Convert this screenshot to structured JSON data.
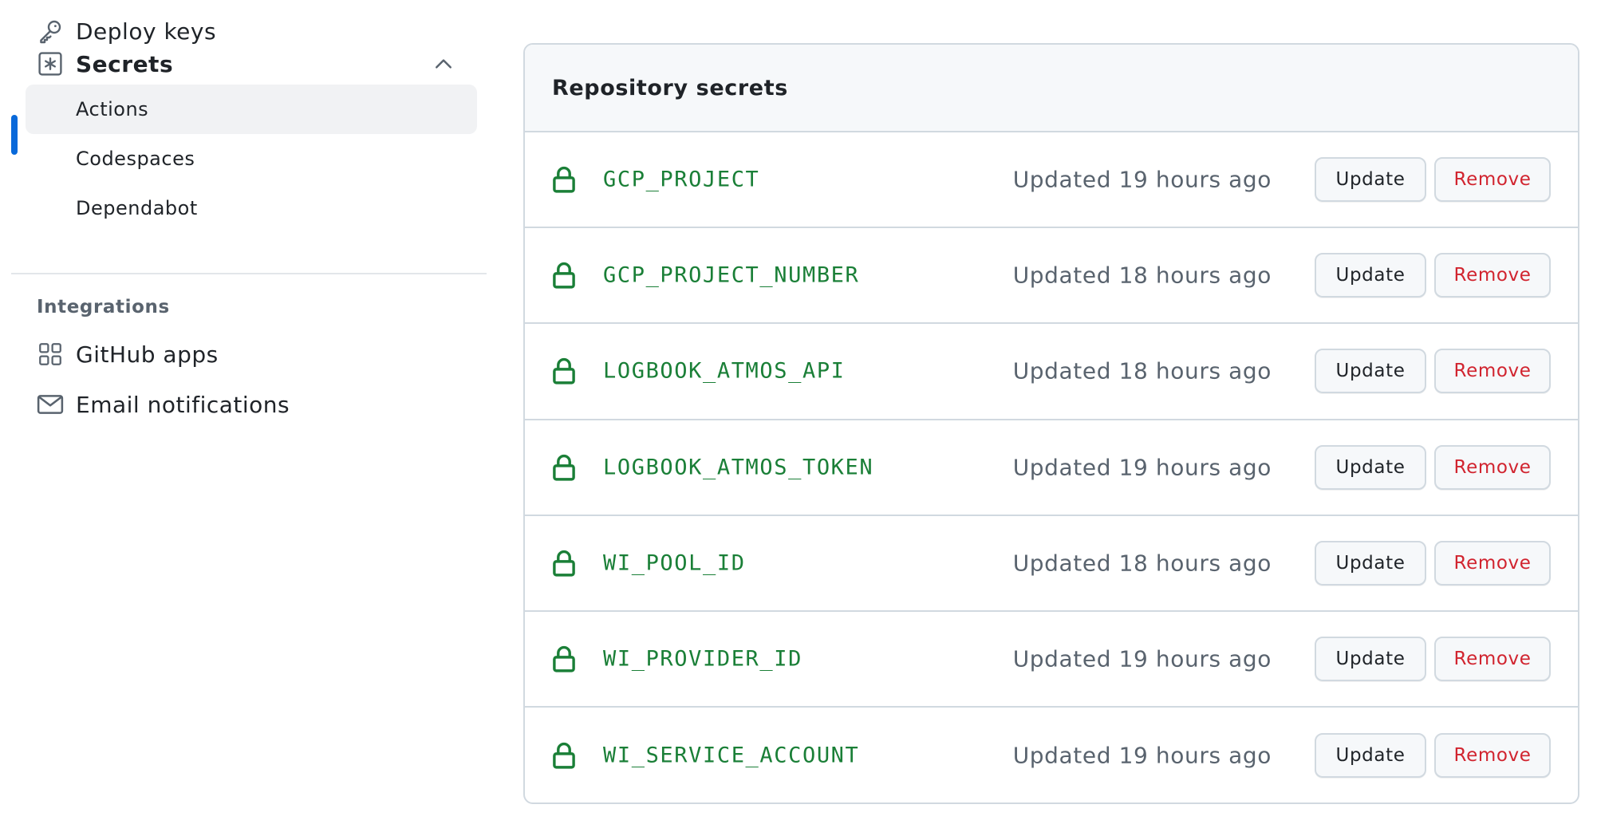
{
  "colors": {
    "accent": "#0969da",
    "secret_name": "#1a7f37",
    "danger": "#d1242f",
    "muted": "#59636e",
    "border": "#d1d9e0"
  },
  "sidebar": {
    "deploy_keys": {
      "label": "Deploy keys",
      "icon": "key-icon"
    },
    "secrets": {
      "label": "Secrets",
      "icon": "asterisk-box-icon",
      "expanded": true,
      "items": [
        {
          "label": "Actions",
          "active": true
        },
        {
          "label": "Codespaces",
          "active": false
        },
        {
          "label": "Dependabot",
          "active": false
        }
      ]
    },
    "integrations": {
      "heading": "Integrations",
      "items": [
        {
          "label": "GitHub apps",
          "icon": "apps-grid-icon"
        },
        {
          "label": "Email notifications",
          "icon": "mail-icon"
        }
      ]
    }
  },
  "main": {
    "title": "Repository secrets",
    "update_label": "Update",
    "remove_label": "Remove",
    "secrets": [
      {
        "name": "GCP_PROJECT",
        "updated": "Updated 19 hours ago"
      },
      {
        "name": "GCP_PROJECT_NUMBER",
        "updated": "Updated 18 hours ago"
      },
      {
        "name": "LOGBOOK_ATMOS_API",
        "updated": "Updated 18 hours ago"
      },
      {
        "name": "LOGBOOK_ATMOS_TOKEN",
        "updated": "Updated 19 hours ago"
      },
      {
        "name": "WI_POOL_ID",
        "updated": "Updated 18 hours ago"
      },
      {
        "name": "WI_PROVIDER_ID",
        "updated": "Updated 19 hours ago"
      },
      {
        "name": "WI_SERVICE_ACCOUNT",
        "updated": "Updated 19 hours ago"
      }
    ]
  }
}
